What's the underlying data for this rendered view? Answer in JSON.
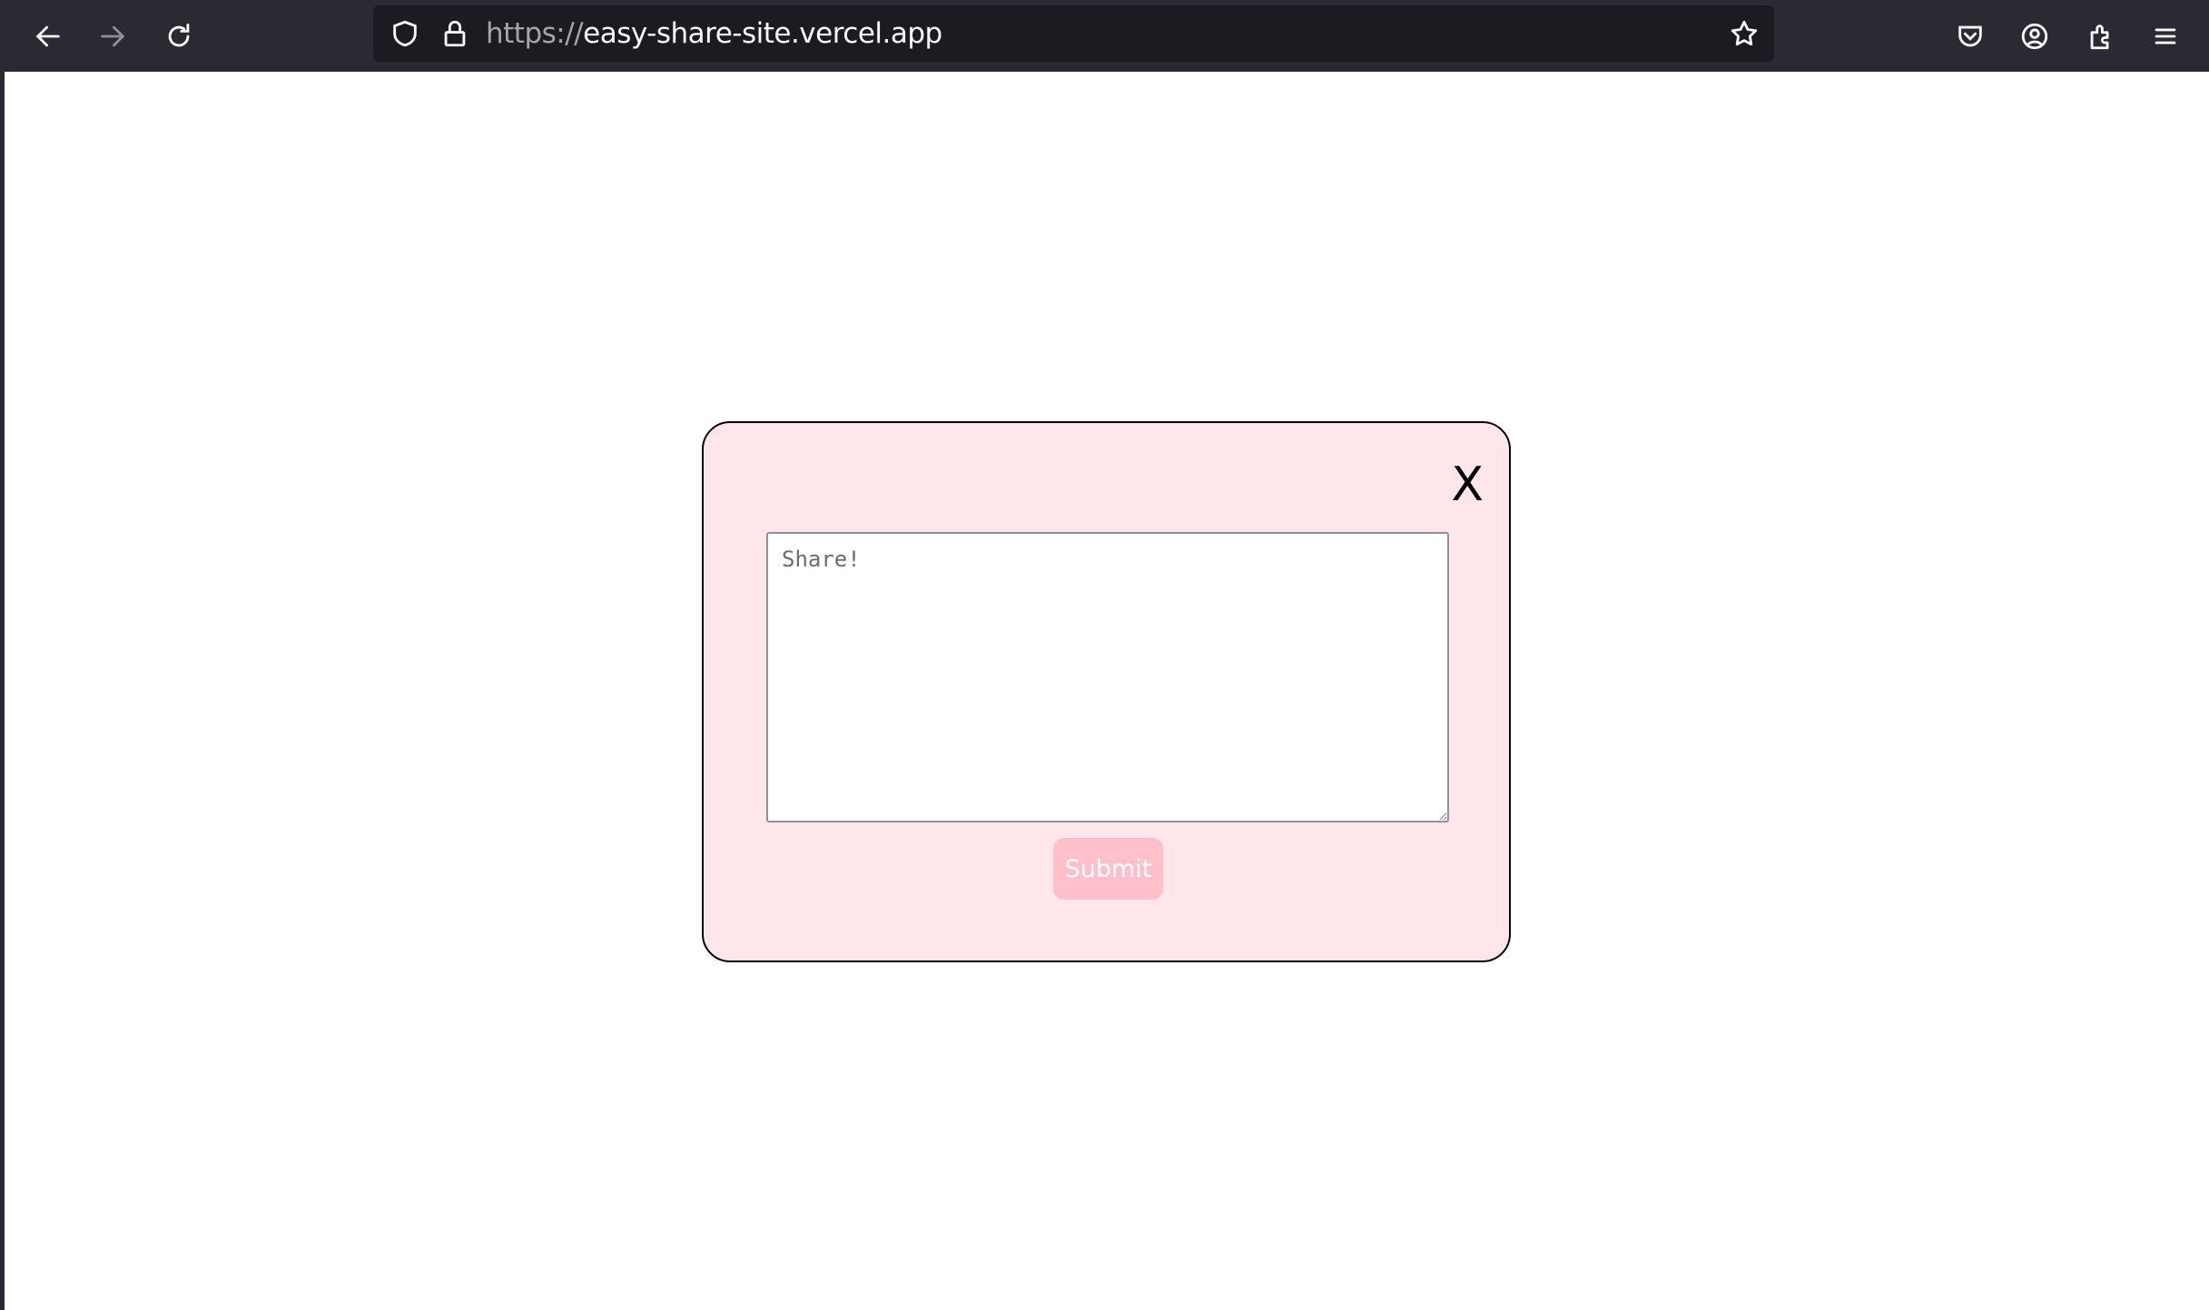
{
  "browser": {
    "url_scheme": "https://",
    "url_host": "easy-share-site.vercel.app",
    "icons": [
      "back-icon",
      "forward-icon",
      "reload-icon",
      "shield-icon",
      "lock-icon",
      "star-icon",
      "pocket-icon",
      "account-icon",
      "extensions-icon",
      "menu-icon"
    ]
  },
  "modal": {
    "close_label": "X",
    "textarea_placeholder": "Share!",
    "textarea_value": "",
    "submit_label": "Submit",
    "background_color": "#ffe6ea",
    "submit_color": "#ffc0cb"
  }
}
